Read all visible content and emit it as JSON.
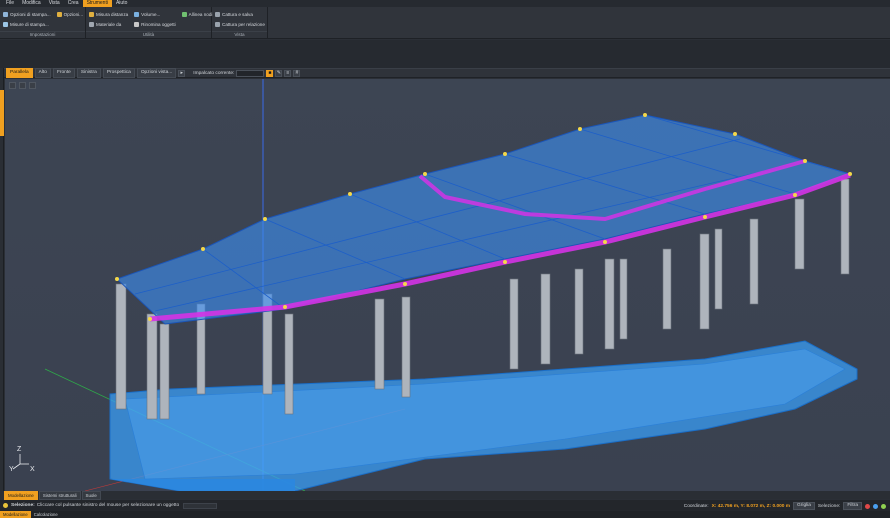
{
  "menubar": {
    "items": [
      "File",
      "Modifica",
      "Vista",
      "Crea",
      "Strumenti",
      "Aiuto"
    ],
    "active_index": 4
  },
  "ribbon": {
    "groups": [
      {
        "title": "Impostazioni",
        "commands": [
          "Opzioni di stampa...",
          "Misure di stampa...",
          "Opzioni..."
        ]
      },
      {
        "title": "Utilità",
        "commands": [
          "Misura distanza",
          "Materiale da",
          "Volume...",
          "Rinomina oggetti",
          "Allinea nodi"
        ]
      },
      {
        "title": "Vista",
        "commands": [
          "Cattura e salva",
          "Cattura per relazione"
        ]
      }
    ]
  },
  "viewbar": {
    "tabs": [
      "Parallela",
      "Alto",
      "Fronte",
      "Sinistra",
      "Prospettica"
    ],
    "active_index": 0,
    "options_label": "Opzioni vista...",
    "plane_label": "Impalcato corrente:"
  },
  "bottom_tabs": {
    "items": [
      "Modellazione",
      "Sistemi strutturali",
      "Suole"
    ],
    "active_index": 0
  },
  "status": {
    "mode_label": "Selezione:",
    "message": "Cliccare col pulsante sinistro del mouse per selezionare un oggetto",
    "coord_label": "Coordinate:",
    "coord_value": "X: 42.756 m, Y: 8.072 m, Z: 0.000 m",
    "grid_label": "Griglia",
    "selection_label": "Selezione:",
    "filter_label": "Filtra"
  },
  "bottom2": {
    "items": [
      "Modellazione",
      "Calcolazione"
    ],
    "active_index": 0
  },
  "axis": {
    "y": "Y",
    "z": "Z",
    "x": "X"
  },
  "colors": {
    "accent": "#f0a020",
    "slab": "#2f8df0",
    "beam_highlight": "#d030e0",
    "column": "#b9bec6"
  }
}
